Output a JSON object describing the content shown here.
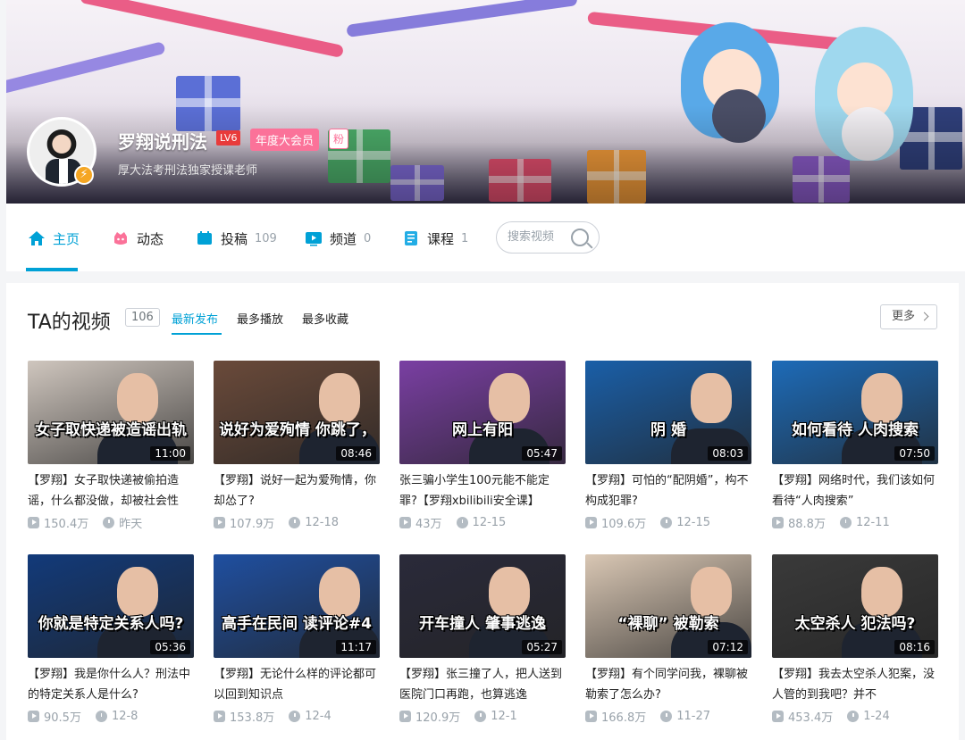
{
  "profile": {
    "name": "罗翔说刑法",
    "level": "LV6",
    "vip_badge": "年度大会员",
    "fan_badge": "粉",
    "signature": "厚大法考刑法独家授课老师"
  },
  "nav": {
    "items": [
      {
        "label": "主页",
        "count": "",
        "icon": "home-icon",
        "active": true
      },
      {
        "label": "动态",
        "count": "",
        "icon": "dynamic-icon",
        "active": false
      },
      {
        "label": "投稿",
        "count": "109",
        "icon": "upload-icon",
        "active": false
      },
      {
        "label": "频道",
        "count": "0",
        "icon": "channel-icon",
        "active": false
      },
      {
        "label": "课程",
        "count": "1",
        "icon": "course-icon",
        "active": false
      }
    ],
    "search_placeholder": "搜索视频"
  },
  "videos_section": {
    "title": "TA的视频",
    "count": "106",
    "filters": [
      "最新发布",
      "最多播放",
      "最多收藏"
    ],
    "more_label": "更多"
  },
  "videos": [
    {
      "caption": "女子取快递被造谣出轨",
      "duration": "11:00",
      "title": "【罗翔】女子取快递被偷拍造谣，什么都没做，却被社会性",
      "views": "150.4万",
      "date": "昨天",
      "bg": "#cfc6be"
    },
    {
      "caption": "说好为爱殉情 你跳了，他没跳",
      "duration": "08:46",
      "title": "【罗翔】说好一起为爱殉情，你却怂了?",
      "views": "107.9万",
      "date": "12-18",
      "bg": "#6a4a3a"
    },
    {
      "caption": "网上有阳",
      "duration": "05:47",
      "title": "张三骗小学生100元能不能定罪?【罗翔xbilibili安全课】",
      "views": "43万",
      "date": "12-15",
      "bg": "#7a3fa3"
    },
    {
      "caption": "阴 婚",
      "duration": "08:03",
      "title": "【罗翔】可怕的“配阴婚”，构不构成犯罪?",
      "views": "109.6万",
      "date": "12-15",
      "bg": "#1a5fa8"
    },
    {
      "caption": "如何看待 人肉搜索",
      "duration": "07:50",
      "title": "【罗翔】网络时代，我们该如何看待“人肉搜索”",
      "views": "88.8万",
      "date": "12-11",
      "bg": "#1d6bb8"
    },
    {
      "caption": "你就是特定关系人吗?",
      "duration": "05:36",
      "title": "【罗翔】我是你什么人？刑法中的特定关系人是什么?",
      "views": "90.5万",
      "date": "12-8",
      "bg": "#123a7a"
    },
    {
      "caption": "高手在民间 读评论#4",
      "duration": "11:17",
      "title": "【罗翔】无论什么样的评论都可以回到知识点",
      "views": "153.8万",
      "date": "12-4",
      "bg": "#1f4fa0"
    },
    {
      "caption": "开车撞人 肇事逃逸",
      "duration": "05:27",
      "title": "【罗翔】张三撞了人，把人送到医院门口再跑，也算逃逸",
      "views": "120.9万",
      "date": "12-1",
      "bg": "#2a2a3a"
    },
    {
      "caption": "“裸聊” 被勒索",
      "duration": "07:12",
      "title": "【罗翔】有个同学问我，裸聊被勒索了怎么办?",
      "views": "166.8万",
      "date": "11-27",
      "bg": "#d9c7b4"
    },
    {
      "caption": "太空杀人 犯法吗?",
      "duration": "08:16",
      "title": "【罗翔】我去太空杀人犯案，没人管的到我吧？并不",
      "views": "453.4万",
      "date": "1-24",
      "bg": "#3a3a3a"
    }
  ],
  "colors": {
    "accent": "#00a1d6",
    "pink": "#fb7299",
    "level": "#e83b3b",
    "meta": "#99a2aa"
  }
}
